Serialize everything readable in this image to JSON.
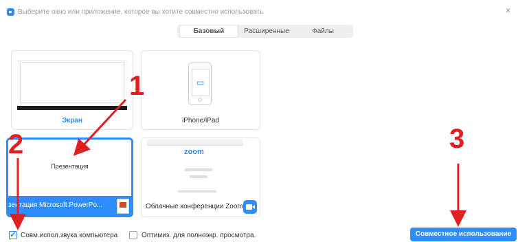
{
  "window": {
    "title": "Выберите окно или приложение, которое вы хотите совместно использовать",
    "close_glyph": "×"
  },
  "tabs": [
    {
      "label": "Базовый",
      "active": true
    },
    {
      "label": "Расширенные",
      "active": false
    },
    {
      "label": "Файлы",
      "active": false
    }
  ],
  "tiles": {
    "screen": {
      "label": "Экран"
    },
    "iphone": {
      "label": "iPhone/iPad"
    },
    "presentation": {
      "preview_text": "Презентация",
      "label": "зентация Microsoft PowerPo...",
      "icon": "powerpoint-icon"
    },
    "zoom": {
      "logo": "zoom",
      "label": "Облачные конференции Zoom",
      "icon": "zoom-camera-icon"
    }
  },
  "options": {
    "share_sound": {
      "label": "Совм.испол.звука компьютера",
      "checked": true
    },
    "optimize": {
      "label": "Оптимиз. для полноэкр. просмотра.",
      "checked": false
    }
  },
  "share_button": {
    "label": "Совместное использование"
  },
  "annotations": [
    "1",
    "2",
    "3"
  ],
  "colors": {
    "accent": "#2d8cff",
    "annotation": "#e02020"
  }
}
